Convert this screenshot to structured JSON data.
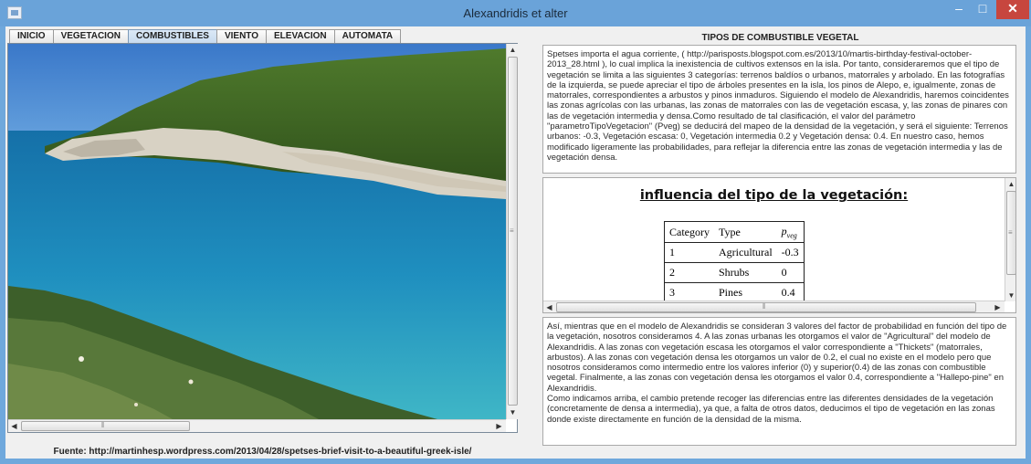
{
  "window": {
    "title": "Alexandridis et alter",
    "minimize": "–",
    "maximize": "□",
    "close": "✕"
  },
  "tabs": [
    {
      "label": "INICIO",
      "active": false
    },
    {
      "label": "VEGETACION",
      "active": false
    },
    {
      "label": "COMBUSTIBLES",
      "active": true
    },
    {
      "label": "VIENTO",
      "active": false
    },
    {
      "label": "ELEVACION",
      "active": false
    },
    {
      "label": "AUTOMATA",
      "active": false
    }
  ],
  "image_panel": {
    "source": "Fuente: http://martinhesp.wordpress.com/2013/04/28/spetses-brief-visit-to-a-beautiful-greek-isle/",
    "photo_subject": "Spetses coastline: rocky headland with pine trees over turquoise sea"
  },
  "right": {
    "title": "TIPOS DE COMBUSTIBLE VEGETAL",
    "text1": "Spetses importa el agua corriente, ( http://parisposts.blogspot.com.es/2013/10/martis-birthday-festival-october-2013_28.html ), lo cual implica la inexistencia de cultivos extensos en la isla. Por tanto, consideraremos que el tipo de vegetación se limita a las siguientes 3 categorías: terrenos baldíos o urbanos, matorrales y arbolado. En las fotografías de la izquierda, se puede apreciar el tipo de árboles presentes en la isla, los pinos de Alepo, e, igualmente, zonas de matorrales, correspondientes a arbustos y pinos inmaduros. Siguiendo el modelo de Alexandridis, haremos coincidentes las zonas agrícolas con las urbanas, las zonas de matorrales con las de vegetación escasa, y, las zonas de pinares con las de vegetación intermedia y densa.Como resultado de tal clasificación, el valor del parámetro \"parametroTipoVegetacion\" (Pveg) se deducirá del mapeo de la densidad de la vegetación, y será el siguiente: Terrenos urbanos: -0.3, Vegetación escasa: 0, Vegetación intermedia 0.2 y Vegetación densa: 0.4. En nuestro caso, hemos modificado ligeramente las probabilidades, para reflejar la diferencia entre las zonas de vegetación intermedia y las de vegetación densa.",
    "doc_title": "influencia del tipo de la vegetación:",
    "table": {
      "headers": [
        "Category",
        "Type",
        "p",
        "veg"
      ],
      "rows": [
        [
          "1",
          "Agricultural",
          "-0.3"
        ],
        [
          "2",
          "Shrubs",
          "0"
        ],
        [
          "3",
          "Pines",
          "0.4"
        ]
      ]
    },
    "text2a": "Así, mientras que en el modelo de Alexandridis se consideran 3 valores del factor de probabilidad en función del tipo de la vegetación, nosotros consideramos 4. A las zonas urbanas les otorgamos el valor de \"Agricultural\" del modelo de Alexandridis. A las zonas con vegetación escasa les otorgamos el valor correspondiente a \"Thickets\" (matorrales, arbustos). A las zonas con vegetación densa les otorgamos un valor de 0.2, el cual no existe en el modelo pero que nosotros consideramos como intermedio entre los valores inferior (0) y superior(0.4) de las zonas con combustible vegetal. Finalmente, a las zonas con vegetación densa les otorgamos el valor 0.4, correspondiente a \"Hallepo-pine\" en Alexandridis.",
    "text2b": " Como indicamos arriba, el cambio pretende recoger las diferencias entre las diferentes densidades de la vegetación (concretamente de densa a intermedia), ya que, a falta de otros datos, deducimos el tipo de vegetación en las zonas donde existe directamente en función de la densidad de la misma."
  },
  "colors": {
    "titlebar": "#6aa3d9",
    "close_button": "#c7463e",
    "active_tab": "#c8dbef",
    "sea": "#1f8fbf"
  },
  "icons": {
    "app": "java-app-icon",
    "scroll_up": "▲",
    "scroll_down": "▼",
    "scroll_left": "◀",
    "scroll_right": "▶",
    "grip_h": "⦀",
    "grip_v": "≡"
  }
}
